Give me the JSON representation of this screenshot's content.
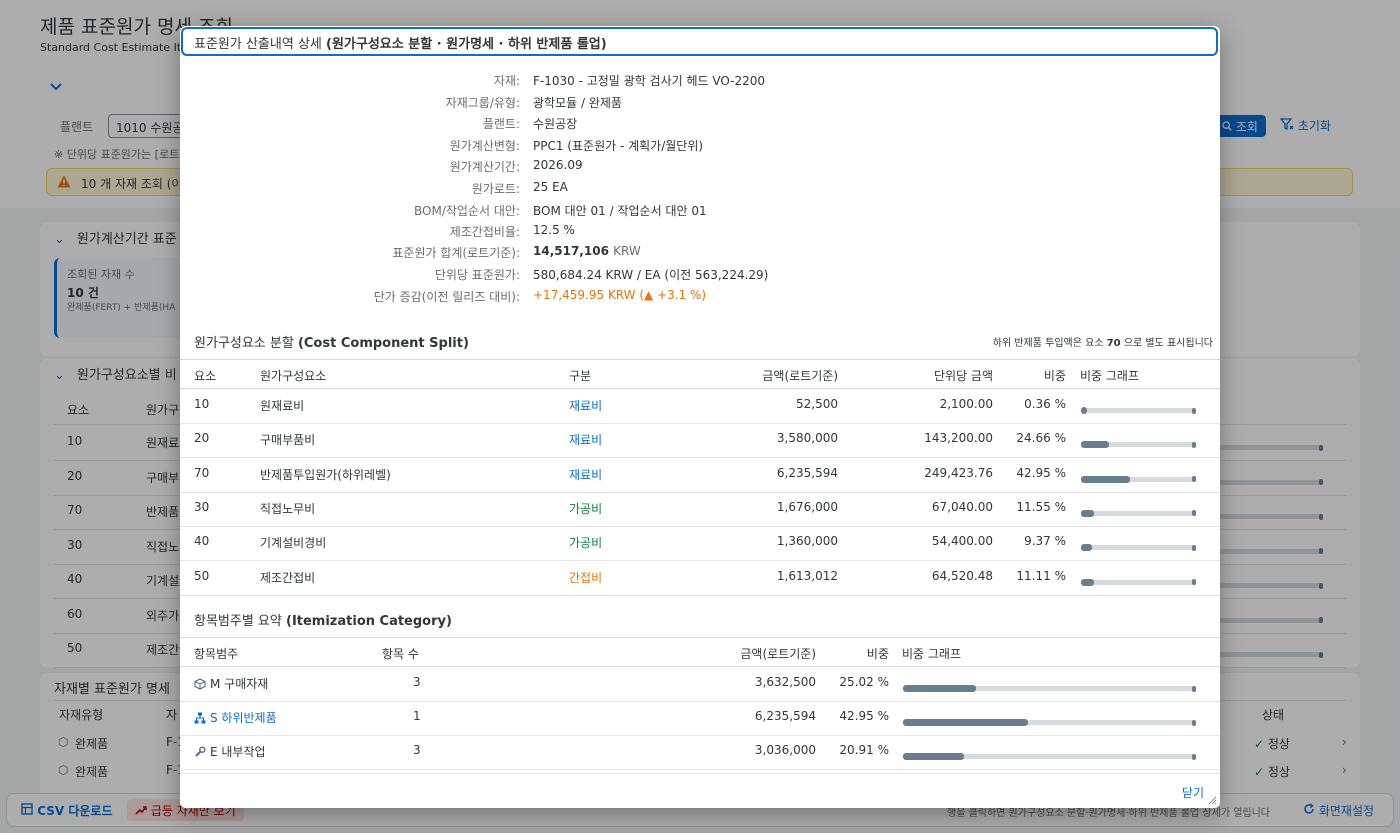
{
  "background": {
    "title": "제품 표준원가 명세 조회",
    "subtitle": "Standard Cost Estimate Item",
    "plant_label": "플랜트",
    "plant_value": "1010 수원공장",
    "note": "※ 단위당 표준원가는 [로트기",
    "warning": "10 개 자재 조회 (이",
    "go_button": "조회",
    "reset_button": "초기화",
    "panel1_title": "원가계산기간 표준",
    "kpi_label": "조회된 자재 수",
    "kpi_value": "10 건",
    "kpi_sub": "완제품(FERT) + 반제품(HA",
    "panel2_title": "원가구성요소별 비",
    "panel2_header": [
      "요소",
      "원가구"
    ],
    "panel2_rows": [
      {
        "code": "10",
        "name": "원재료"
      },
      {
        "code": "20",
        "name": "구매부"
      },
      {
        "code": "70",
        "name": "반제품"
      },
      {
        "code": "30",
        "name": "직접노"
      },
      {
        "code": "40",
        "name": "기계설"
      },
      {
        "code": "60",
        "name": "외주가"
      },
      {
        "code": "50",
        "name": "제조간"
      }
    ],
    "panel3_title": "자재별 표준원가 명세",
    "panel3_header": [
      "자재유형",
      "자",
      "상태"
    ],
    "panel3_rows": [
      {
        "type": "완제품",
        "mat": "F-1",
        "status": "정상"
      },
      {
        "type": "완제품",
        "mat": "F-1",
        "status": "정상"
      }
    ],
    "toolbar": {
      "csv": "CSV 다운로드",
      "surge": "급등 자재만 보기",
      "hint": "행을 클릭하면 원가구성요소 분할·원가명세·하위 반제품 롤업 상세가 열립니다",
      "settings": "화면재설정"
    }
  },
  "dialog": {
    "title_main": "표준원가 산출내역 상세",
    "title_sub": "(원가구성요소 분할 · 원가명세 · 하위 반제품 롤업)",
    "info": [
      {
        "label": "자재:",
        "value": "F-1030 - 고정밀 광학 검사기 헤드 VO-2200"
      },
      {
        "label": "자재그룹/유형:",
        "value": "광학모듈 / 완제품"
      },
      {
        "label": "플랜트:",
        "value": "수원공장"
      },
      {
        "label": "원가계산변형:",
        "value": "PPC1 (표준원가 - 계획가/월단위)"
      },
      {
        "label": "원가계산기간:",
        "value": "2026.09"
      },
      {
        "label": "원가로트:",
        "value": "25 EA"
      },
      {
        "label": "BOM/작업순서 대안:",
        "value": "BOM 대안 01 / 작업순서 대안 01"
      },
      {
        "label": "제조간접비율:",
        "value": "12.5 %"
      }
    ],
    "total": {
      "label": "표준원가 합계(로트기준):",
      "value": "14,517,106",
      "unit": "KRW"
    },
    "unit_cost": {
      "label": "단위당 표준원가:",
      "value": "580,684.24 KRW / EA (이전 563,224.29)"
    },
    "delta": {
      "label": "단가 증감(이전 릴리즈 대비):",
      "value": "+17,459.95 KRW (▲ +3.1 %)"
    },
    "ccs": {
      "title": "원가구성요소 분할",
      "title_en": "(Cost Component Split)",
      "note_prefix": "하위 반제품 투입액은 요소",
      "note_code": "70",
      "note_suffix": "으로 별도 표시됩니다",
      "headers": [
        "요소",
        "원가구성요소",
        "구분",
        "금액(로트기준)",
        "단위당 금액",
        "비중",
        "비중 그래프"
      ],
      "rows": [
        {
          "code": "10",
          "name": "원재료비",
          "category": "재료비",
          "cat_type": "mat",
          "amount": "52,500",
          "unit_amount": "2,100.00",
          "share": "0.36 %",
          "share_value": 0.36
        },
        {
          "code": "20",
          "name": "구매부품비",
          "category": "재료비",
          "cat_type": "mat",
          "amount": "3,580,000",
          "unit_amount": "143,200.00",
          "share": "24.66 %",
          "share_value": 24.66
        },
        {
          "code": "70",
          "name": "반제품투입원가(하위레벨)",
          "category": "재료비",
          "cat_type": "mat",
          "amount": "6,235,594",
          "unit_amount": "249,423.76",
          "share": "42.95 %",
          "share_value": 42.95
        },
        {
          "code": "30",
          "name": "직접노무비",
          "category": "가공비",
          "cat_type": "proc",
          "amount": "1,676,000",
          "unit_amount": "67,040.00",
          "share": "11.55 %",
          "share_value": 11.55
        },
        {
          "code": "40",
          "name": "기계설비경비",
          "category": "가공비",
          "cat_type": "proc",
          "amount": "1,360,000",
          "unit_amount": "54,400.00",
          "share": "9.37 %",
          "share_value": 9.37
        },
        {
          "code": "50",
          "name": "제조간접비",
          "category": "간접비",
          "cat_type": "ovh",
          "amount": "1,613,012",
          "unit_amount": "64,520.48",
          "share": "11.11 %",
          "share_value": 11.11
        }
      ]
    },
    "icat": {
      "title": "항목범주별 요약",
      "title_en": "(Itemization Category)",
      "headers": [
        "항목범주",
        "항목 수",
        "금액(로트기준)",
        "비중",
        "비중 그래프"
      ],
      "rows": [
        {
          "icon": "cube-icon",
          "name": "M 구매자재",
          "count": "3",
          "amount": "3,632,500",
          "share": "25.02 %",
          "share_value": 25.02,
          "link": false
        },
        {
          "icon": "hierarchy-icon",
          "name": "S 하위반제품",
          "count": "1",
          "amount": "6,235,594",
          "share": "42.95 %",
          "share_value": 42.95,
          "link": true
        },
        {
          "icon": "wrench-icon",
          "name": "E 내부작업",
          "count": "3",
          "amount": "3,036,000",
          "share": "20.91 %",
          "share_value": 20.91,
          "link": false
        }
      ]
    },
    "close_button": "닫기"
  }
}
